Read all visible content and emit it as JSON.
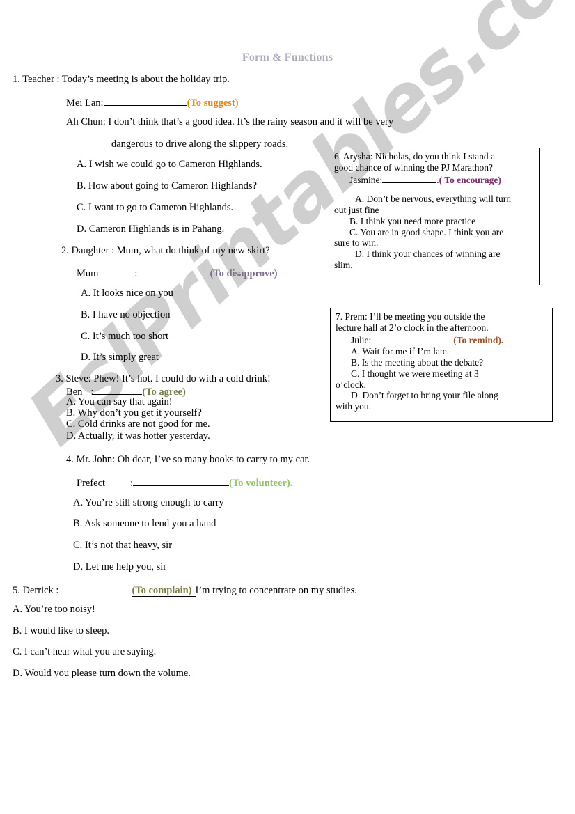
{
  "document": {
    "title": "Form & Functions",
    "watermark": "EslPrintables.com",
    "title_color": "#b3aabf"
  },
  "questions": [
    {
      "number": "1.",
      "speaker_line": "1. Teacher : Today’s meeting is about the holiday trip.",
      "answer_speaker": "Mei Lan:",
      "function_tag": "(To suggest)",
      "function_color": "#e08a1e",
      "context_line_1": "Ah Chun: I don’t think that’s a good idea. It’s the rainy season and it will be very",
      "context_line_2": "dangerous to drive along the slippery roads.",
      "options": [
        "A. I wish we could go to Cameron Highlands.",
        "B. How about going to Cameron Highlands?",
        "C. I want to go to Cameron Highlands.",
        "D. Cameron Highlands is in Pahang."
      ]
    },
    {
      "number": "2.",
      "speaker_line": "2. Daughter : Mum, what do think of my new skirt?",
      "answer_speaker": "Mum",
      "answer_colon": ":",
      "function_tag": "(To disapprove)",
      "function_color": "#7b6d8d",
      "options": [
        "A. It looks nice on you",
        "B. I have no objection",
        "C. It’s much too short",
        "D. It’s simply great"
      ]
    },
    {
      "number": "3.",
      "speaker_line": "3. Steve: Phew! It’s hot. I could do with a cold drink!",
      "answer_speaker": "Ben",
      "answer_colon": ":",
      "function_tag": "(To agree)",
      "function_color": "#767b4e",
      "options": [
        "A.   You can say that again!",
        "B. Why don’t you get it yourself?",
        "C. Cold drinks are not good for me.",
        "D. Actually, it was hotter yesterday."
      ]
    },
    {
      "number": "4.",
      "speaker_line": "4. Mr. John: Oh dear, I’ve so many books to carry to my car.",
      "answer_speaker": "Prefect",
      "answer_colon": ":",
      "function_tag": "(To volunteer).",
      "function_color": "#93c36b",
      "options": [
        "A. You’re still strong enough to carry",
        "B. Ask someone to lend you a hand",
        "C. It’s not that heavy, sir",
        "D. Let me help you, sir"
      ]
    },
    {
      "number": "5.",
      "speaker_prefix": "5. Derrick :",
      "function_tag": "(To complain)",
      "function_color": "#7d7a43",
      "speaker_suffix": "I’m trying to concentrate on my studies.",
      "options": [
        "A. You’re too noisy!",
        "B. I would like to sleep.",
        "C. I can’t hear what you are saying.",
        "D. Would you please turn down the volume."
      ]
    }
  ],
  "boxes": [
    {
      "number": "6.",
      "prompt_line_1": "6.  Arysha:  Nicholas,  do  you  think  I  stand  a",
      "prompt_line_2": "good chance of winning the PJ Marathon?",
      "answer_speaker": "Jasmine:",
      "answer_tail": ".",
      "function_tag": "( To encourage)",
      "function_color": "#7a2f6e",
      "options": [
        "A.  Don’t  be  nervous,  everything  will  turn",
        "out just fine",
        "B. I think you need more practice",
        "C.  You  are  in  good  shape.  I  think  you  are",
        "sure to win.",
        "D.  I  think  your  chances  of  winning  are",
        "slim."
      ]
    },
    {
      "number": "7.",
      "prompt_line_1": "7. Prem: I’ll be meeting you outside the",
      "prompt_line_2": "lecture hall at 2’o clock in the afternoon.",
      "answer_speaker": "Julie:",
      "function_tag": "(To remind).",
      "function_color": "#a0522d",
      "options": [
        "A.  Wait for me if I’m late.",
        "B. Is the meeting about the debate?",
        "C. I thought we were meeting at 3",
        "o’clock.",
        "D. Don’t forget to bring your file along",
        "with you."
      ]
    }
  ]
}
